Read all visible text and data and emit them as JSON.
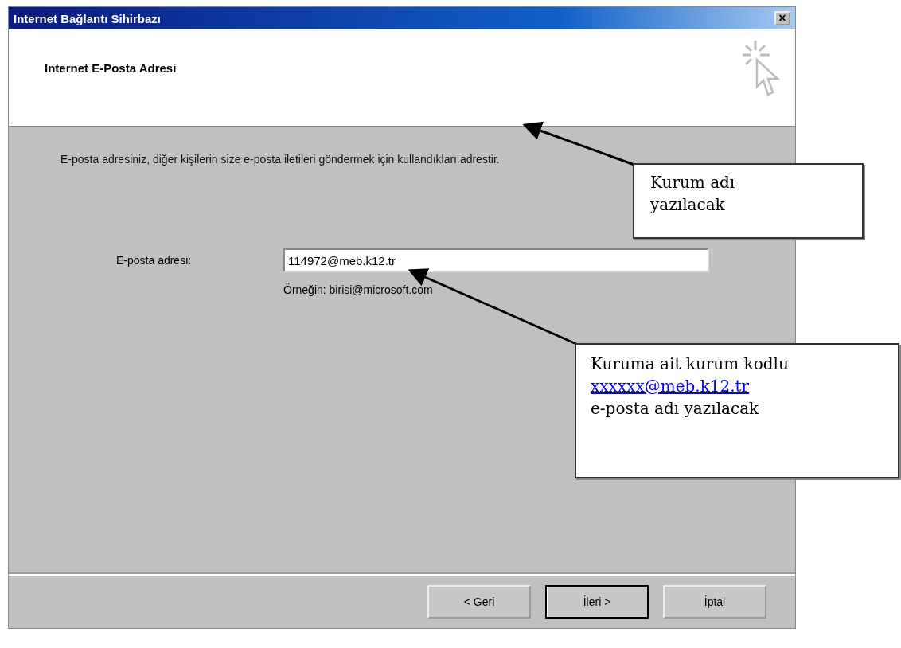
{
  "window": {
    "title": "Internet Bağlantı Sihirbazı",
    "close": "×"
  },
  "header": {
    "title": "Internet E-Posta Adresi"
  },
  "description": "E-posta adresiniz, diğer kişilerin size e-posta iletileri göndermek için kullandıkları adrestir.",
  "email_field": {
    "label": "E-posta adresi:",
    "value": "114972@meb.k12.tr",
    "example": "Örneğin: birisi@microsoft.com"
  },
  "buttons": [
    {
      "label": "< Geri",
      "default": false
    },
    {
      "label": "İleri >",
      "default": true
    },
    {
      "label": "İptal",
      "default": false
    }
  ],
  "callouts": [
    {
      "lines": [
        "Kurum adı",
        "yazılacak"
      ]
    },
    {
      "lines": [
        "Kuruma ait kurum kodlu",
        "e-posta adı yazılacak"
      ],
      "link": "xxxxxx@meb.k12.tr"
    }
  ]
}
